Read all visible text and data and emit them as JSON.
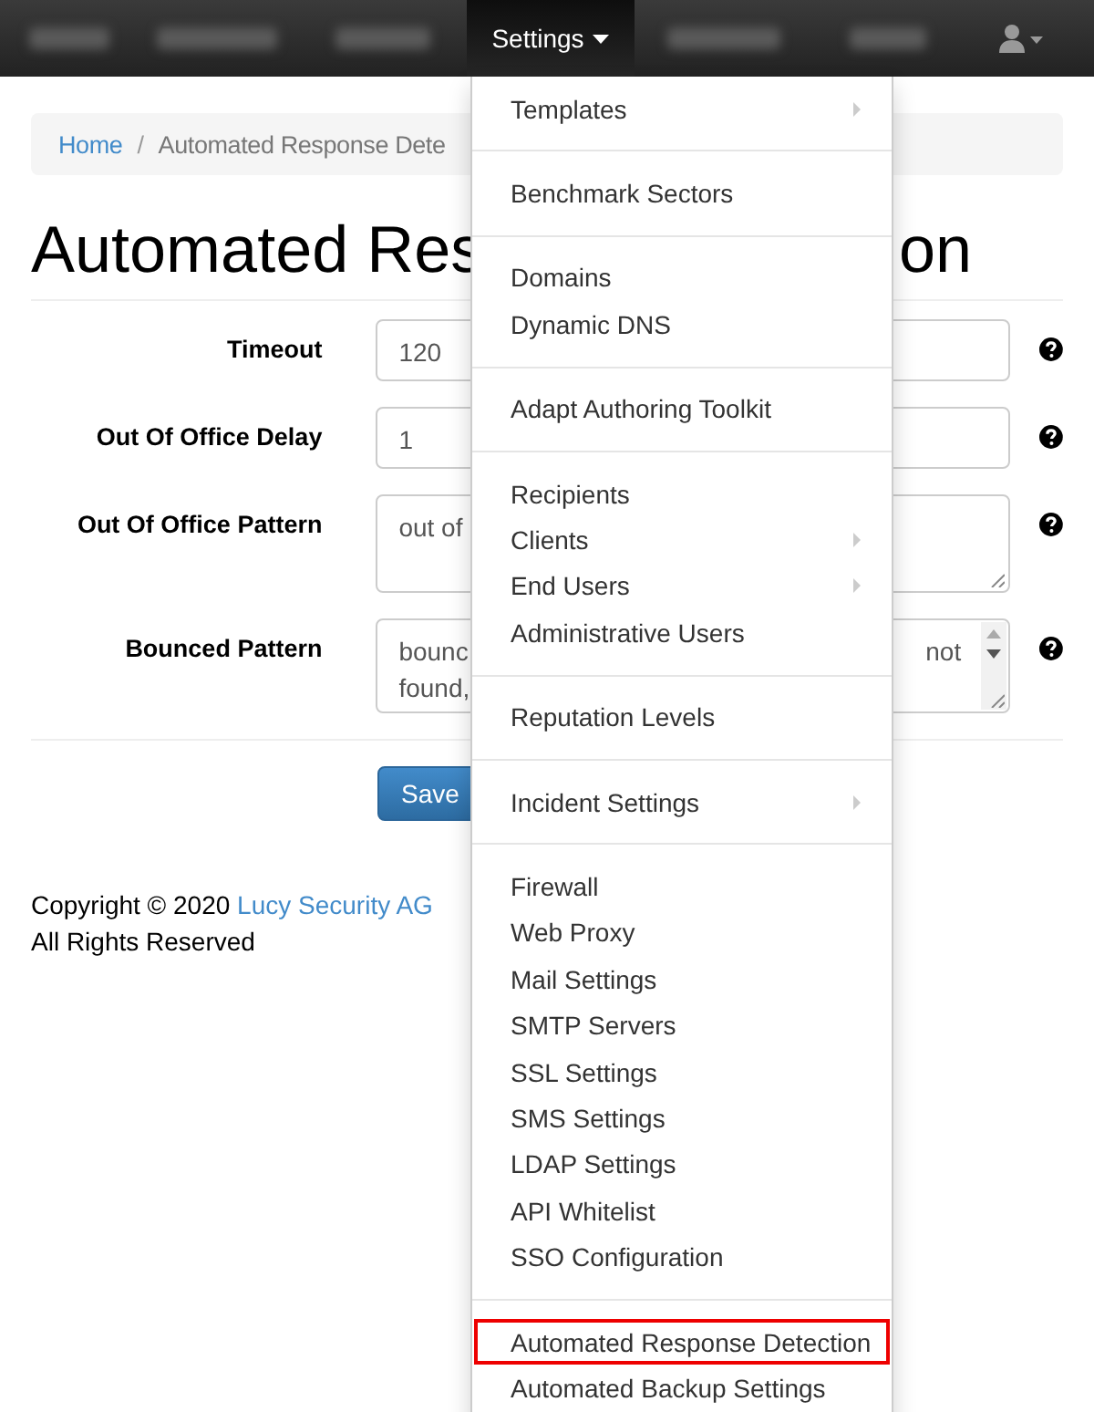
{
  "navbar": {
    "active_menu": "Settings"
  },
  "breadcrumb_separator": "/",
  "breadcrumb": [
    {
      "label": "Home",
      "kind": "link"
    },
    {
      "label": "Automated Response Dete",
      "kind": "current"
    }
  ],
  "heading": {
    "left": "Automated Res",
    "right": "on"
  },
  "form": {
    "fields": [
      {
        "label": "Timeout",
        "kind": "input",
        "value": "120"
      },
      {
        "label": "Out Of Office Delay",
        "kind": "input",
        "value": "1"
      },
      {
        "label": "Out Of Office Pattern",
        "kind": "textarea",
        "value": "out of"
      },
      {
        "label": "Bounced Pattern",
        "kind": "textarea",
        "value": "bounc\nfound,",
        "value_right": "not",
        "scrollbar": true
      }
    ],
    "submit": "Save"
  },
  "footer": {
    "copyright": "Copyright © 2020 ",
    "company": "Lucy Security AG",
    "rights": "All Rights Reserved"
  },
  "settings_menu": {
    "groups": [
      [
        {
          "label": "Templates",
          "submenu": true,
          "highlighted": false
        }
      ],
      [
        {
          "label": "Benchmark Sectors",
          "submenu": false,
          "highlighted": false
        }
      ],
      [
        {
          "label": "Domains",
          "submenu": false,
          "highlighted": false
        },
        {
          "label": "Dynamic DNS",
          "submenu": false,
          "highlighted": false
        }
      ],
      [
        {
          "label": "Adapt Authoring Toolkit",
          "submenu": false,
          "highlighted": false
        }
      ],
      [
        {
          "label": "Recipients",
          "submenu": false,
          "highlighted": false
        },
        {
          "label": "Clients",
          "submenu": true,
          "highlighted": false
        },
        {
          "label": "End Users",
          "submenu": true,
          "highlighted": false
        },
        {
          "label": "Administrative Users",
          "submenu": false,
          "highlighted": false
        }
      ],
      [
        {
          "label": "Reputation Levels",
          "submenu": false,
          "highlighted": false
        }
      ],
      [
        {
          "label": "Incident Settings",
          "submenu": true,
          "highlighted": false
        }
      ],
      [
        {
          "label": "Firewall",
          "submenu": false,
          "highlighted": false
        },
        {
          "label": "Web Proxy",
          "submenu": false,
          "highlighted": false
        },
        {
          "label": "Mail Settings",
          "submenu": false,
          "highlighted": false
        },
        {
          "label": "SMTP Servers",
          "submenu": false,
          "highlighted": false
        },
        {
          "label": "SSL Settings",
          "submenu": false,
          "highlighted": false
        },
        {
          "label": "SMS Settings",
          "submenu": false,
          "highlighted": false
        },
        {
          "label": "LDAP Settings",
          "submenu": false,
          "highlighted": false
        },
        {
          "label": "API Whitelist",
          "submenu": false,
          "highlighted": false
        },
        {
          "label": "SSO Configuration",
          "submenu": false,
          "highlighted": false
        }
      ],
      [
        {
          "label": "Automated Response Detection",
          "submenu": false,
          "highlighted": true
        },
        {
          "label": "Automated Backup Settings",
          "submenu": false,
          "highlighted": false
        }
      ]
    ]
  }
}
